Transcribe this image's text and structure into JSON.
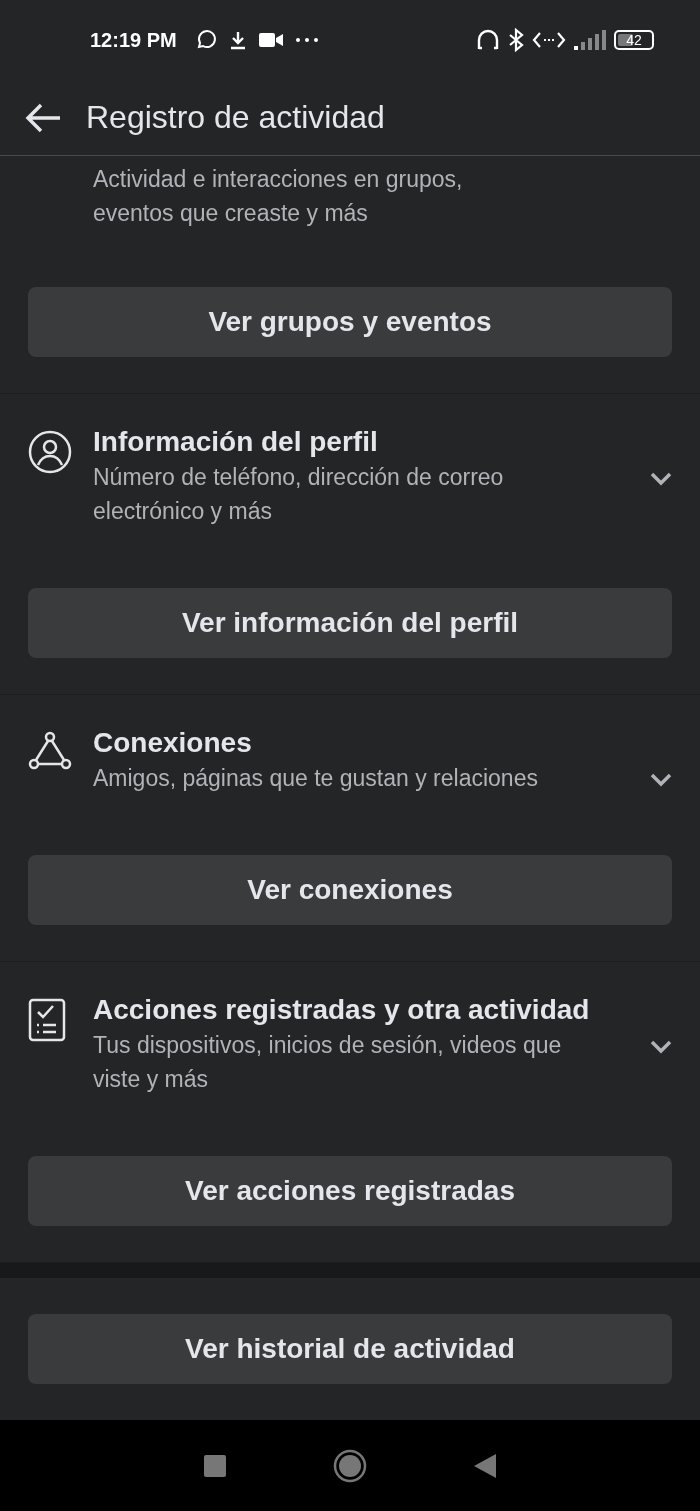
{
  "status_bar": {
    "time": "12:19 PM",
    "battery": "42"
  },
  "header": {
    "title": "Registro de actividad"
  },
  "sections": [
    {
      "description": "Actividad e interacciones en grupos, eventos que creaste y más",
      "button": "Ver grupos y eventos"
    },
    {
      "title": "Información del perfil",
      "description": "Número de teléfono, dirección de correo electrónico y más",
      "button": "Ver información del perfil"
    },
    {
      "title": "Conexiones",
      "description": "Amigos, páginas que te gustan y relaciones",
      "button": "Ver conexiones"
    },
    {
      "title": "Acciones registradas y otra actividad",
      "description": "Tus dispositivos, inicios de sesión, videos que viste y más",
      "button": "Ver acciones registradas"
    }
  ],
  "footer": {
    "button": "Ver historial de actividad"
  }
}
